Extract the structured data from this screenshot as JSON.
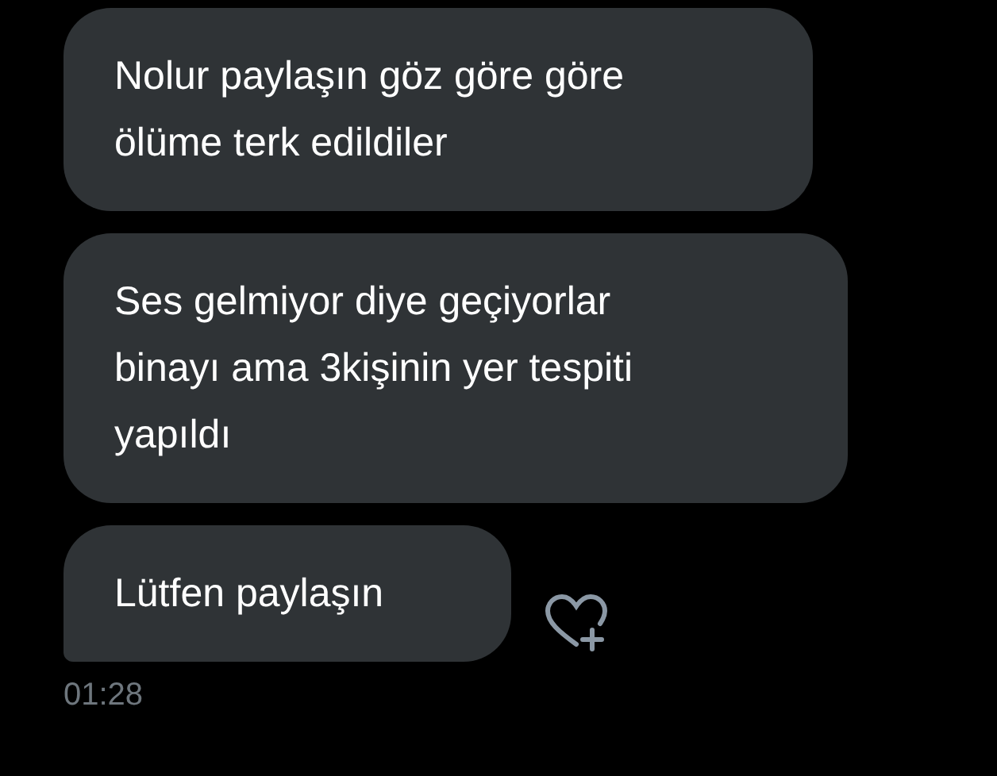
{
  "messages": [
    {
      "text": "Nolur paylaşın göz göre göre\nölüme terk edildiler",
      "last": false
    },
    {
      "text": "Ses gelmiyor diye geçiyorlar\nbinayı ama 3kişinin yer tespiti\nyapıldı",
      "last": false
    },
    {
      "text": "Lütfen paylaşın",
      "last": true
    }
  ],
  "time": "01:28"
}
